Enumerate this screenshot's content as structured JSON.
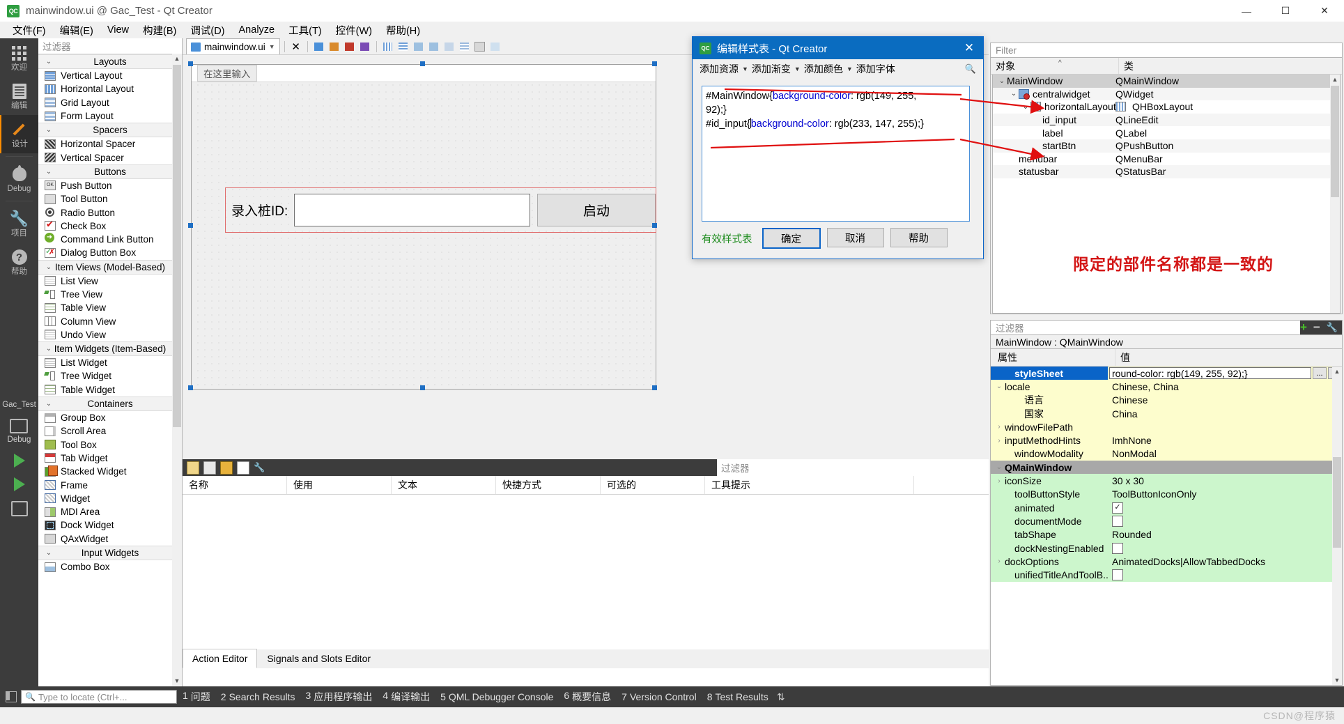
{
  "titlebar": {
    "logo": "QC",
    "title": "mainwindow.ui @ Gac_Test - Qt Creator",
    "minimize": "—",
    "maximize": "☐",
    "close": "✕"
  },
  "menubar": {
    "items": [
      {
        "label": "文件(F)"
      },
      {
        "label": "编辑(E)"
      },
      {
        "label": "View"
      },
      {
        "label": "构建(B)"
      },
      {
        "label": "调试(D)"
      },
      {
        "label": "Analyze"
      },
      {
        "label": "工具(T)"
      },
      {
        "label": "控件(W)"
      },
      {
        "label": "帮助(H)"
      }
    ]
  },
  "modebar": {
    "items": [
      {
        "label": "欢迎",
        "icon": "grid-icon",
        "active": false
      },
      {
        "label": "编辑",
        "icon": "document-icon",
        "active": false
      },
      {
        "label": "设计",
        "icon": "pencil-icon",
        "active": true
      },
      {
        "label": "Debug",
        "icon": "bug-icon",
        "active": false
      },
      {
        "label": "项目",
        "icon": "wrench-icon",
        "active": false
      },
      {
        "label": "帮助",
        "icon": "question-icon",
        "active": false
      }
    ],
    "kit": {
      "project": "Gac_Test",
      "config": "Debug"
    }
  },
  "widgetbox": {
    "filter_placeholder": "过滤器",
    "groups": [
      {
        "title": "Layouts",
        "items": [
          {
            "label": "Vertical Layout",
            "icon": "vertical-layout-icon",
            "cls": "ico-vlayout"
          },
          {
            "label": "Horizontal Layout",
            "icon": "horizontal-layout-icon",
            "cls": "ico-hlayout"
          },
          {
            "label": "Grid Layout",
            "icon": "grid-layout-icon",
            "cls": "ico-grid"
          },
          {
            "label": "Form Layout",
            "icon": "form-layout-icon",
            "cls": "ico-grid"
          }
        ]
      },
      {
        "title": "Spacers",
        "items": [
          {
            "label": "Horizontal Spacer",
            "icon": "horizontal-spacer-icon",
            "cls": "ico-spacer-h"
          },
          {
            "label": "Vertical Spacer",
            "icon": "vertical-spacer-icon",
            "cls": "ico-spacer-v"
          }
        ]
      },
      {
        "title": "Buttons",
        "items": [
          {
            "label": "Push Button",
            "icon": "push-button-icon",
            "cls": "ico-push"
          },
          {
            "label": "Tool Button",
            "icon": "tool-button-icon",
            "cls": "ico-tool"
          },
          {
            "label": "Radio Button",
            "icon": "radio-button-icon",
            "cls": "ico-circle"
          },
          {
            "label": "Check Box",
            "icon": "check-box-icon",
            "cls": "ico-check ico-white"
          },
          {
            "label": "Command Link Button",
            "icon": "command-link-button-icon",
            "cls": "ico-cmd"
          },
          {
            "label": "Dialog Button Box",
            "icon": "dialog-button-box-icon",
            "cls": "ico-dlg ico-white"
          }
        ]
      },
      {
        "title": "Item Views (Model-Based)",
        "items": [
          {
            "label": "List View",
            "icon": "list-view-icon",
            "cls": "ico-list"
          },
          {
            "label": "Tree View",
            "icon": "tree-view-icon",
            "cls": "ico-tree"
          },
          {
            "label": "Table View",
            "icon": "table-view-icon",
            "cls": "ico-table"
          },
          {
            "label": "Column View",
            "icon": "column-view-icon",
            "cls": "ico-col"
          },
          {
            "label": "Undo View",
            "icon": "undo-view-icon",
            "cls": "ico-list"
          }
        ]
      },
      {
        "title": "Item Widgets (Item-Based)",
        "items": [
          {
            "label": "List Widget",
            "icon": "list-widget-icon",
            "cls": "ico-list"
          },
          {
            "label": "Tree Widget",
            "icon": "tree-widget-icon",
            "cls": "ico-tree"
          },
          {
            "label": "Table Widget",
            "icon": "table-widget-icon",
            "cls": "ico-table"
          }
        ]
      },
      {
        "title": "Containers",
        "items": [
          {
            "label": "Group Box",
            "icon": "group-box-icon",
            "cls": "ico-groupbox"
          },
          {
            "label": "Scroll Area",
            "icon": "scroll-area-icon",
            "cls": "ico-scroll"
          },
          {
            "label": "Tool Box",
            "icon": "tool-box-icon",
            "cls": "ico-toolbox"
          },
          {
            "label": "Tab Widget",
            "icon": "tab-widget-icon",
            "cls": "ico-tab"
          },
          {
            "label": "Stacked Widget",
            "icon": "stacked-widget-icon",
            "cls": "ico-stack"
          },
          {
            "label": "Frame",
            "icon": "frame-icon",
            "cls": "ico-hatch"
          },
          {
            "label": "Widget",
            "icon": "widget-icon",
            "cls": "ico-hatch"
          },
          {
            "label": "MDI Area",
            "icon": "mdi-area-icon",
            "cls": "ico-mdi"
          },
          {
            "label": "Dock Widget",
            "icon": "dock-widget-icon",
            "cls": "ico-dock"
          },
          {
            "label": "QAxWidget",
            "icon": "qax-widget-icon",
            "cls": "ico-qax"
          }
        ]
      },
      {
        "title": "Input Widgets",
        "items": [
          {
            "label": "Combo Box",
            "icon": "combo-box-icon",
            "cls": "ico-combo"
          }
        ]
      }
    ]
  },
  "formeditor": {
    "tab_label": "mainwindow.ui",
    "type_placeholder": "在这里输入",
    "label_text": "录入桩ID:",
    "lineedit_text": "",
    "button_text": "启动"
  },
  "actioneditor": {
    "filter_placeholder": "过滤器",
    "columns": [
      "名称",
      "使用",
      "文本",
      "快捷方式",
      "可选的",
      "工具提示"
    ],
    "tabs": [
      {
        "label": "Action Editor",
        "active": true
      },
      {
        "label": "Signals and Slots Editor",
        "active": false
      }
    ]
  },
  "objectinspector": {
    "filter_placeholder": "Filter",
    "columns": [
      "对象",
      "类"
    ],
    "rows": [
      {
        "name": "MainWindow",
        "cls": "QMainWindow",
        "indent": 0,
        "chev": "⌄",
        "selected": true,
        "icon": ""
      },
      {
        "name": "centralwidget",
        "cls": "QWidget",
        "indent": 1,
        "chev": "⌄",
        "selected": false,
        "icon": "central-widget-icon"
      },
      {
        "name": "horizontalLayout",
        "cls": "QHBoxLayout",
        "indent": 2,
        "chev": "⌄",
        "selected": false,
        "icon": "hbox-layout-icon"
      },
      {
        "name": "id_input",
        "cls": "QLineEdit",
        "indent": 3,
        "chev": "",
        "selected": false,
        "icon": ""
      },
      {
        "name": "label",
        "cls": "QLabel",
        "indent": 3,
        "chev": "",
        "selected": false,
        "icon": ""
      },
      {
        "name": "startBtn",
        "cls": "QPushButton",
        "indent": 3,
        "chev": "",
        "selected": false,
        "icon": ""
      },
      {
        "name": "menubar",
        "cls": "QMenuBar",
        "indent": 1,
        "chev": "",
        "selected": false,
        "icon": ""
      },
      {
        "name": "statusbar",
        "cls": "QStatusBar",
        "indent": 1,
        "chev": "",
        "selected": false,
        "icon": ""
      }
    ],
    "annotation": "限定的部件名称都是一致的"
  },
  "propertyeditor": {
    "filter_placeholder": "过滤器",
    "object_line": "MainWindow : QMainWindow",
    "columns": [
      "属性",
      "值"
    ],
    "add_icon": "+",
    "remove_icon": "−",
    "config_icon": "wrench-icon",
    "rows": [
      {
        "name": "styleSheet",
        "value": "round-color: rgb(149, 255, 92);}",
        "bg": "bgYellow",
        "selected": true,
        "indent": 1,
        "exp": "",
        "kind": "edit",
        "ellipsis": "...",
        "revert": "↩"
      },
      {
        "name": "locale",
        "value": "Chinese, China",
        "bg": "bgYellow",
        "selected": false,
        "indent": 0,
        "exp": "⌄",
        "kind": "text"
      },
      {
        "name": "语言",
        "value": "Chinese",
        "bg": "bgYellow",
        "selected": false,
        "indent": 2,
        "exp": "",
        "kind": "text"
      },
      {
        "name": "国家",
        "value": "China",
        "bg": "bgYellow",
        "selected": false,
        "indent": 2,
        "exp": "",
        "kind": "text"
      },
      {
        "name": "windowFilePath",
        "value": "",
        "bg": "bgYellow",
        "selected": false,
        "indent": 0,
        "exp": "›",
        "kind": "text"
      },
      {
        "name": "inputMethodHints",
        "value": "ImhNone",
        "bg": "bgYellow",
        "selected": false,
        "indent": 0,
        "exp": "›",
        "kind": "text"
      },
      {
        "name": "windowModality",
        "value": "NonModal",
        "bg": "bgYellow",
        "selected": false,
        "indent": 1,
        "exp": "",
        "kind": "text"
      },
      {
        "name": "QMainWindow",
        "value": "",
        "bg": "bgGray",
        "selected": false,
        "indent": 0,
        "exp": "⌄",
        "kind": "group"
      },
      {
        "name": "iconSize",
        "value": "30 x 30",
        "bg": "bgGreen",
        "selected": false,
        "indent": 0,
        "exp": "›",
        "kind": "text"
      },
      {
        "name": "toolButtonStyle",
        "value": "ToolButtonIconOnly",
        "bg": "bgGreen",
        "selected": false,
        "indent": 1,
        "exp": "",
        "kind": "text"
      },
      {
        "name": "animated",
        "value": "✓",
        "bg": "bgGreen",
        "selected": false,
        "indent": 1,
        "exp": "",
        "kind": "checkbox",
        "checked": true
      },
      {
        "name": "documentMode",
        "value": "",
        "bg": "bgGreen",
        "selected": false,
        "indent": 1,
        "exp": "",
        "kind": "checkbox",
        "checked": false
      },
      {
        "name": "tabShape",
        "value": "Rounded",
        "bg": "bgGreen",
        "selected": false,
        "indent": 1,
        "exp": "",
        "kind": "text"
      },
      {
        "name": "dockNestingEnabled",
        "value": "",
        "bg": "bgGreen",
        "selected": false,
        "indent": 1,
        "exp": "",
        "kind": "checkbox",
        "checked": false
      },
      {
        "name": "dockOptions",
        "value": "AnimatedDocks|AllowTabbedDocks",
        "bg": "bgGreen",
        "selected": false,
        "indent": 0,
        "exp": "›",
        "kind": "text"
      },
      {
        "name": "unifiedTitleAndToolB...",
        "value": "",
        "bg": "bgGreen",
        "selected": false,
        "indent": 1,
        "exp": "",
        "kind": "checkbox",
        "checked": false
      }
    ]
  },
  "dialog": {
    "logo": "QC",
    "title": "编辑样式表 - Qt Creator",
    "close": "✕",
    "tools": [
      {
        "label": "添加资源",
        "caret": true
      },
      {
        "label": "添加渐变",
        "caret": true
      },
      {
        "label": "添加颜色",
        "caret": true
      },
      {
        "label": "添加字体",
        "caret": false
      }
    ],
    "editor": {
      "line1_sel": "#MainWindow{",
      "line1_kw": "background-color",
      "line1_rest": ": rgb(149, 255,",
      "line2": "92);}",
      "line3_sel": "#id_input{",
      "line3_kw": "background-color",
      "line3_rest": ": rgb(233, 147, 255);}"
    },
    "valid_text": "有效样式表",
    "buttons": [
      {
        "label": "确定",
        "default": true
      },
      {
        "label": "取消",
        "default": false
      },
      {
        "label": "帮助",
        "default": false
      }
    ]
  },
  "outputbar": {
    "locator_placeholder": "Type to locate (Ctrl+...",
    "items": [
      {
        "num": "1",
        "label": "问题"
      },
      {
        "num": "2",
        "label": "Search Results"
      },
      {
        "num": "3",
        "label": "应用程序输出"
      },
      {
        "num": "4",
        "label": "编译输出"
      },
      {
        "num": "5",
        "label": "QML Debugger Console"
      },
      {
        "num": "6",
        "label": "概要信息"
      },
      {
        "num": "7",
        "label": "Version Control"
      },
      {
        "num": "8",
        "label": "Test Results"
      }
    ],
    "updown": "⇅"
  },
  "watermark": "CSDN@程序猿"
}
